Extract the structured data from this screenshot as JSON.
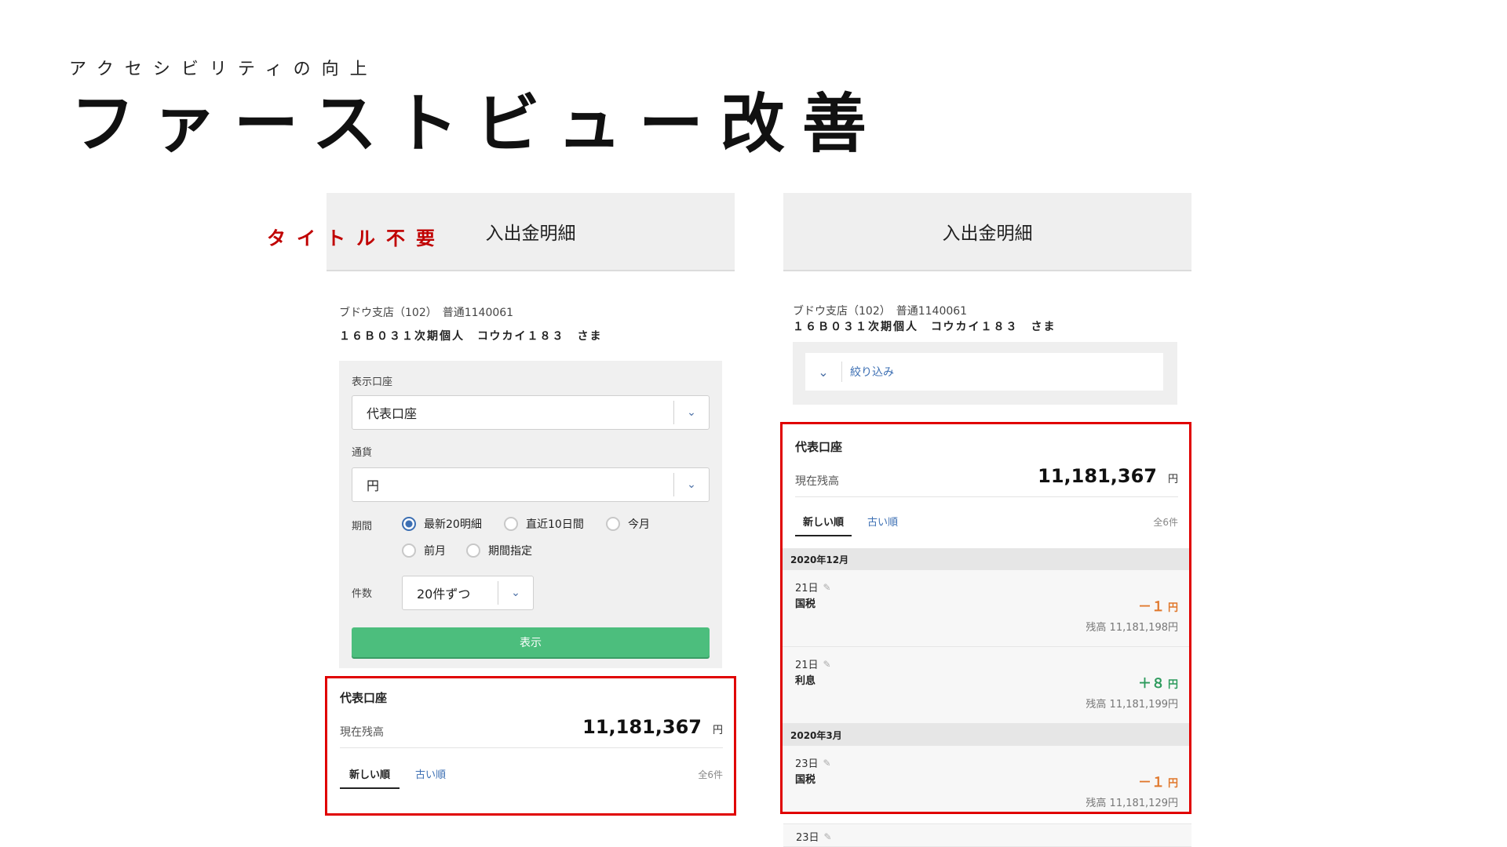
{
  "slide": {
    "subtitle": "アクセシビリティの向上",
    "title": "ファーストビュー改善",
    "note": "タイトル不要"
  },
  "left": {
    "header_title": "入出金明細",
    "account_line": "ブドウ支店（102）　普通1140061",
    "account_name": "１６Ｂ０３１次期個人　コウカイ１８３　さま",
    "form": {
      "display_account_label": "表示口座",
      "display_account_value": "代表口座",
      "currency_label": "通貨",
      "currency_value": "円",
      "period_label": "期間",
      "period_options": [
        "最新20明細",
        "直近10日間",
        "今月",
        "前月",
        "期間指定"
      ],
      "period_selected": "最新20明細",
      "count_label": "件数",
      "count_value": "20件ずつ",
      "show_button": "表示"
    },
    "card": {
      "title": "代表口座",
      "balance_label": "現在残高",
      "balance_value": "11,181,367",
      "currency_unit": "円",
      "tab_new": "新しい順",
      "tab_old": "古い順",
      "total_count": "全6件"
    }
  },
  "right": {
    "header_title": "入出金明細",
    "account_line": "ブドウ支店（102）　普通1140061",
    "account_name": "１６Ｂ０３１次期個人　コウカイ１８３　さま",
    "filter_label": "絞り込み",
    "card": {
      "title": "代表口座",
      "balance_label": "現在残高",
      "balance_value": "11,181,367",
      "currency_unit": "円",
      "tab_new": "新しい順",
      "tab_old": "古い順",
      "total_count": "全6件"
    },
    "groups": [
      {
        "month": "2020年12月",
        "transactions": [
          {
            "date": "21日",
            "desc": "国税",
            "amount": "－１",
            "unit": "円",
            "balance": "残高 11,181,198円",
            "type": "out"
          },
          {
            "date": "21日",
            "desc": "利息",
            "amount": "＋８",
            "unit": "円",
            "balance": "残高 11,181,199円",
            "type": "in"
          }
        ]
      },
      {
        "month": "2020年3月",
        "transactions": [
          {
            "date": "23日",
            "desc": "国税",
            "amount": "－１",
            "unit": "円",
            "balance": "残高 11,181,129円",
            "type": "out"
          }
        ]
      }
    ],
    "next_row_date": "23日"
  },
  "colors": {
    "highlight_border": "#e00000",
    "note_text": "#c00000",
    "show_button": "#4cbe7d",
    "link_blue": "#3c6fb3",
    "amount_out": "#e0772b",
    "amount_in": "#2c9a5c"
  },
  "icons": [
    "chevron-down-icon",
    "pencil-icon"
  ]
}
